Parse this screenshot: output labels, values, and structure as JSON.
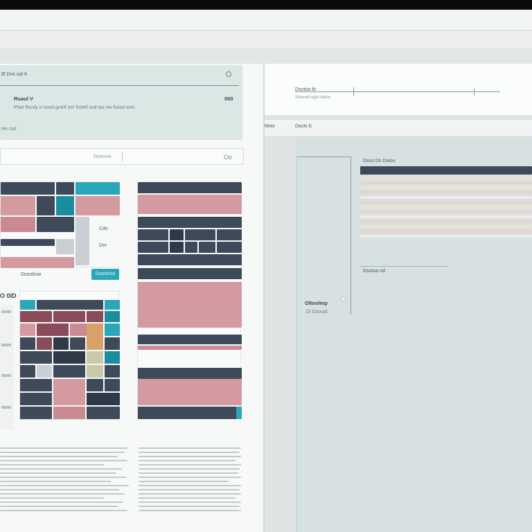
{
  "top_card": {
    "header_label": "Ø Dvo ual tt",
    "header_icon": "settings-icon",
    "title": "Ruaul V",
    "title_value": "000",
    "description": "Ptoe fhuvly o nood gnetf eer fvotrtl svd wu nw foooo enn",
    "footer_label": "Ho rod"
  },
  "search": {
    "value": "Dunuvw",
    "count_label": "Oo"
  },
  "grid_left": {
    "panel_text_1": "Cdo",
    "panel_text_2": "Dvr",
    "panel_button": "Dsotonut",
    "subheader": "Dsonbnw",
    "number_label": "O 0lD"
  },
  "right_header": {
    "label_top": "Dsotoa tb",
    "sub_label": "Stnwwd ogw nanlw",
    "tab_1": "Mntv",
    "tab_2": "Dsotv b"
  },
  "right_panel": {
    "table_header": "Dsvu Dn Dwou",
    "note_label": "Dsotoa nd",
    "side_title": "Oltoolmp",
    "side_sub": "Dl Dvouot"
  },
  "colors": {
    "navy": "#3e4a5a",
    "pink": "#d39aa0",
    "teal": "#2aa7b8",
    "mint": "#dbe7e4"
  }
}
